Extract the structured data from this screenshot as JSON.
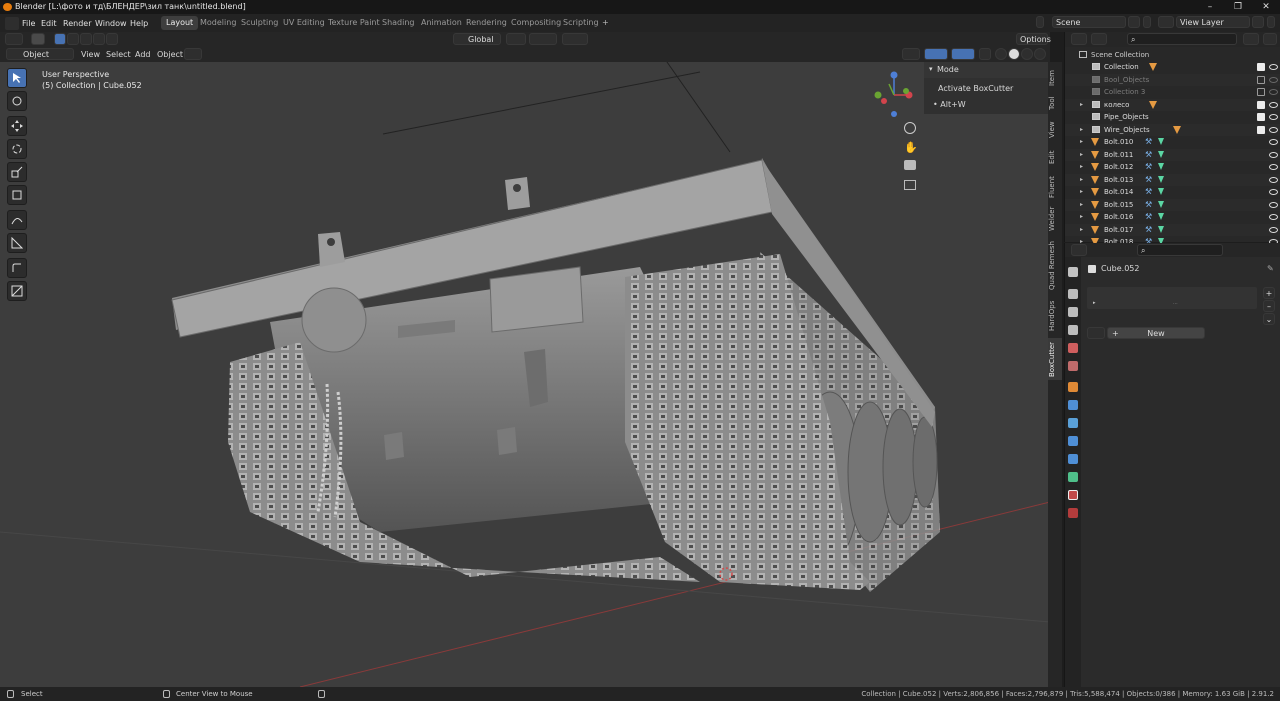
{
  "window": {
    "title": "Blender [L:\\фото и тд\\БЛЕНДЕР\\зил танк\\untitled.blend]"
  },
  "menu": {
    "items": [
      "File",
      "Edit",
      "Render",
      "Window",
      "Help"
    ]
  },
  "workspaces": [
    "Layout",
    "Modeling",
    "Sculpting",
    "UV Editing",
    "Texture Paint",
    "Shading",
    "Animation",
    "Rendering",
    "Compositing",
    "Scripting"
  ],
  "active_workspace": "Layout",
  "scene": {
    "name": "Scene",
    "view_layer": "View Layer"
  },
  "header3d": {
    "mode": "Object Mode",
    "view": "View",
    "select": "Select",
    "add": "Add",
    "object": "Object",
    "orientation": "Global",
    "options": "Options"
  },
  "viewport": {
    "perspective": "User Perspective",
    "context": "(5) Collection | Cube.052"
  },
  "npanel": {
    "section": "Mode",
    "button": "Activate BoxCutter",
    "shortcut": "• Alt+W"
  },
  "vertical_tabs": [
    "Item",
    "Tool",
    "View",
    "Edit",
    "Fluent",
    "Welder",
    "Quad Remesh",
    "HardOps",
    "BoxCutter"
  ],
  "active_vertical_tab": "BoxCutter",
  "outliner": {
    "root": "Scene Collection",
    "rows": [
      {
        "name": "Collection",
        "kind": "collection",
        "dim": false
      },
      {
        "name": "Bool_Objects",
        "kind": "collection",
        "dim": true
      },
      {
        "name": "Collection 3",
        "kind": "collection",
        "dim": true
      },
      {
        "name": "колесо",
        "kind": "collection",
        "dim": false
      },
      {
        "name": "Pipe_Objects",
        "kind": "collection",
        "dim": false
      },
      {
        "name": "Wire_Objects",
        "kind": "collection",
        "dim": false
      },
      {
        "name": "Bolt.010",
        "kind": "mesh",
        "dim": false
      },
      {
        "name": "Bolt.011",
        "kind": "mesh",
        "dim": false
      },
      {
        "name": "Bolt.012",
        "kind": "mesh",
        "dim": false
      },
      {
        "name": "Bolt.013",
        "kind": "mesh",
        "dim": false
      },
      {
        "name": "Bolt.014",
        "kind": "mesh",
        "dim": false
      },
      {
        "name": "Bolt.015",
        "kind": "mesh",
        "dim": false
      },
      {
        "name": "Bolt.016",
        "kind": "mesh",
        "dim": false
      },
      {
        "name": "Bolt.017",
        "kind": "mesh",
        "dim": false
      },
      {
        "name": "Bolt.018",
        "kind": "mesh",
        "dim": false
      }
    ]
  },
  "properties": {
    "object": "Cube.052",
    "new_button": "New"
  },
  "statusbar": {
    "left": "Select",
    "middle": "Center View to Mouse",
    "stats": "Collection | Cube.052 | Verts:2,806,856 | Faces:2,796,879 | Tris:5,588,474 | Objects:0/386 | Memory: 1.63 GiB | 2.91.2"
  },
  "colors": {
    "accent": "#4772b3",
    "viewport_bg": "#3d3d3d",
    "object_orange": "#e59a42",
    "mesh_green": "#5bd6a4"
  }
}
